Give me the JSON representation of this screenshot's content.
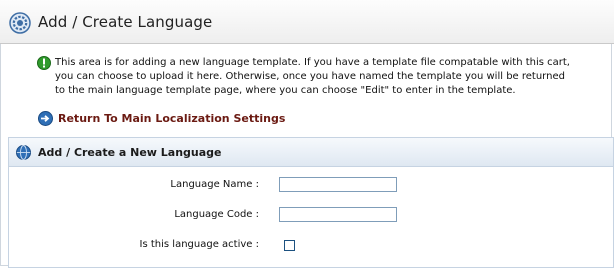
{
  "header": {
    "title": "Add / Create Language"
  },
  "info": {
    "text": "This area is for adding a new language template. If you have a template file compatable with this cart, you can choose to upload it here. Otherwise, once you have named the template you will be returned to the main language template page, where you can choose \"Edit\" to enter in the template."
  },
  "return_link": {
    "label": "Return To Main Localization Settings"
  },
  "panel": {
    "title": "Add / Create a New Language",
    "fields": {
      "name_label": "Language Name :",
      "name_value": "",
      "code_label": "Language Code :",
      "code_value": "",
      "active_label": "Is this language active :"
    }
  },
  "colors": {
    "link": "#6b1a12",
    "panel_header": "#dfe8f2",
    "input_border": "#7f9db9"
  }
}
